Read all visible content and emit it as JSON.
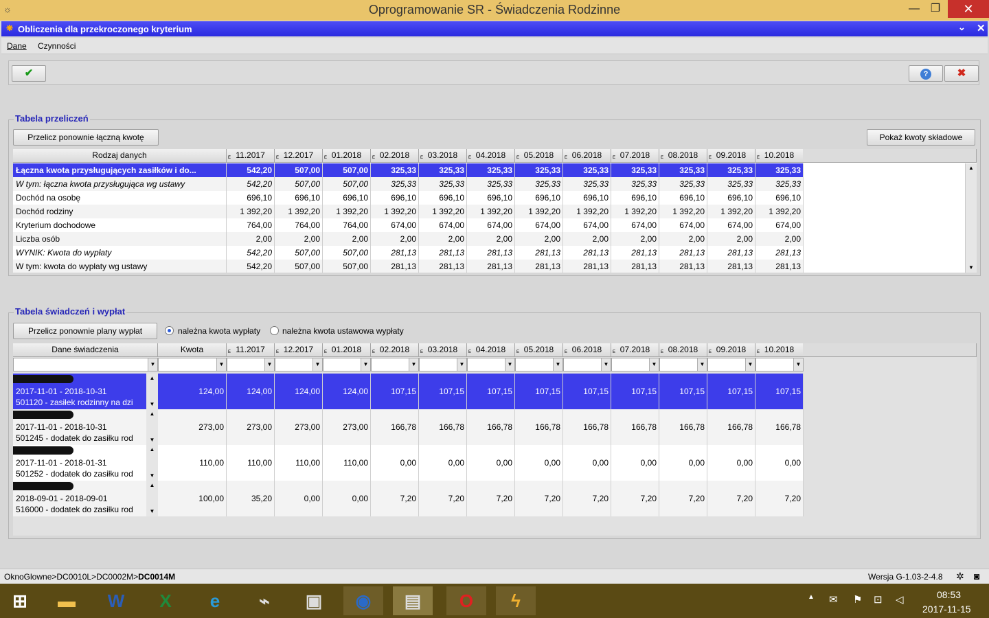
{
  "window": {
    "title": "Oprogramowanie SR - Świadczenia Rodzinne",
    "minimize": "—",
    "maximize": "❐",
    "close": "✕"
  },
  "dialog": {
    "title": "Obliczenia dla przekroczonego kryterium",
    "collapse": "✓",
    "close": "✕"
  },
  "menu": {
    "items": [
      "Dane",
      "Czynności"
    ]
  },
  "toolbar": {
    "ok": "✔",
    "help": "?",
    "cancel": "✖"
  },
  "section1": {
    "legend": "Tabela przeliczeń",
    "recalc_button": "Przelicz ponownie łączną kwotę",
    "show_button": "Pokaż kwoty składowe",
    "header_label": "Rodzaj danych",
    "months": [
      "11.2017",
      "12.2017",
      "01.2018",
      "02.2018",
      "03.2018",
      "04.2018",
      "05.2018",
      "06.2018",
      "07.2018",
      "08.2018",
      "09.2018",
      "10.2018"
    ],
    "rows": [
      {
        "label": "Łączna kwota przysługujących zasiłków i do...",
        "style": "selected",
        "values": [
          "542,20",
          "507,00",
          "507,00",
          "325,33",
          "325,33",
          "325,33",
          "325,33",
          "325,33",
          "325,33",
          "325,33",
          "325,33",
          "325,33"
        ]
      },
      {
        "label": "W tym: łączna kwota przysługująca wg ustawy",
        "style": "italic",
        "values": [
          "542,20",
          "507,00",
          "507,00",
          "325,33",
          "325,33",
          "325,33",
          "325,33",
          "325,33",
          "325,33",
          "325,33",
          "325,33",
          "325,33"
        ]
      },
      {
        "label": "Dochód na osobę",
        "style": "normal",
        "values": [
          "696,10",
          "696,10",
          "696,10",
          "696,10",
          "696,10",
          "696,10",
          "696,10",
          "696,10",
          "696,10",
          "696,10",
          "696,10",
          "696,10"
        ]
      },
      {
        "label": "Dochód rodziny",
        "style": "normal",
        "values": [
          "1 392,20",
          "1 392,20",
          "1 392,20",
          "1 392,20",
          "1 392,20",
          "1 392,20",
          "1 392,20",
          "1 392,20",
          "1 392,20",
          "1 392,20",
          "1 392,20",
          "1 392,20"
        ]
      },
      {
        "label": "Kryterium dochodowe",
        "style": "normal",
        "values": [
          "764,00",
          "764,00",
          "764,00",
          "674,00",
          "674,00",
          "674,00",
          "674,00",
          "674,00",
          "674,00",
          "674,00",
          "674,00",
          "674,00"
        ]
      },
      {
        "label": "Liczba osób",
        "style": "normal",
        "values": [
          "2,00",
          "2,00",
          "2,00",
          "2,00",
          "2,00",
          "2,00",
          "2,00",
          "2,00",
          "2,00",
          "2,00",
          "2,00",
          "2,00"
        ]
      },
      {
        "label": "WYNIK: Kwota do wypłaty",
        "style": "italic",
        "values": [
          "542,20",
          "507,00",
          "507,00",
          "281,13",
          "281,13",
          "281,13",
          "281,13",
          "281,13",
          "281,13",
          "281,13",
          "281,13",
          "281,13"
        ]
      },
      {
        "label": "W tym: kwota do wypłaty wg ustawy",
        "style": "normal",
        "values": [
          "542,20",
          "507,00",
          "507,00",
          "281,13",
          "281,13",
          "281,13",
          "281,13",
          "281,13",
          "281,13",
          "281,13",
          "281,13",
          "281,13"
        ]
      }
    ]
  },
  "section2": {
    "legend": "Tabela świadczeń i wypłat",
    "recalc_button": "Przelicz ponownie plany wypłat",
    "radio1": "należna kwota wypłaty",
    "radio2": "należna kwota ustawowa wypłaty",
    "header_label": "Dane świadczenia",
    "header_amount": "Kwota",
    "months": [
      "11.2017",
      "12.2017",
      "01.2018",
      "02.2018",
      "03.2018",
      "04.2018",
      "05.2018",
      "06.2018",
      "07.2018",
      "08.2018",
      "09.2018",
      "10.2018"
    ],
    "rows": [
      {
        "line1": "2017-11-01 - 2018-10-31",
        "line2": "501120 - zasiłek rodzinny na dzi",
        "kwota": "124,00",
        "values": [
          "124,00",
          "124,00",
          "124,00",
          "107,15",
          "107,15",
          "107,15",
          "107,15",
          "107,15",
          "107,15",
          "107,15",
          "107,15",
          "107,15"
        ]
      },
      {
        "line1": "2017-11-01 - 2018-10-31",
        "line2": "501245 - dodatek do zasiłku rod",
        "kwota": "273,00",
        "values": [
          "273,00",
          "273,00",
          "273,00",
          "166,78",
          "166,78",
          "166,78",
          "166,78",
          "166,78",
          "166,78",
          "166,78",
          "166,78",
          "166,78"
        ]
      },
      {
        "line1": "2017-11-01 - 2018-01-31",
        "line2": "501252 - dodatek do zasiłku rod",
        "kwota": "110,00",
        "values": [
          "110,00",
          "110,00",
          "110,00",
          "0,00",
          "0,00",
          "0,00",
          "0,00",
          "0,00",
          "0,00",
          "0,00",
          "0,00",
          "0,00"
        ]
      },
      {
        "line1": "2018-09-01 - 2018-09-01",
        "line2": "516000 - dodatek do zasiłku rod",
        "kwota": "100,00",
        "values": [
          "35,20",
          "0,00",
          "0,00",
          "7,20",
          "7,20",
          "7,20",
          "7,20",
          "7,20",
          "7,20",
          "7,20",
          "7,20",
          "7,20"
        ]
      }
    ]
  },
  "status": {
    "path": "OknoGlowne>DC0010L>DC0002M>",
    "path_bold": "DC0014M",
    "version": "Wersja G-1.03-2-4.8"
  },
  "taskbar": {
    "time": "08:53",
    "date": "2017-11-15"
  },
  "colors": {
    "selection": "#3d3dea",
    "titlebar": "#e9c46a",
    "legend": "#2828b8",
    "taskbar": "#5a4a14"
  }
}
